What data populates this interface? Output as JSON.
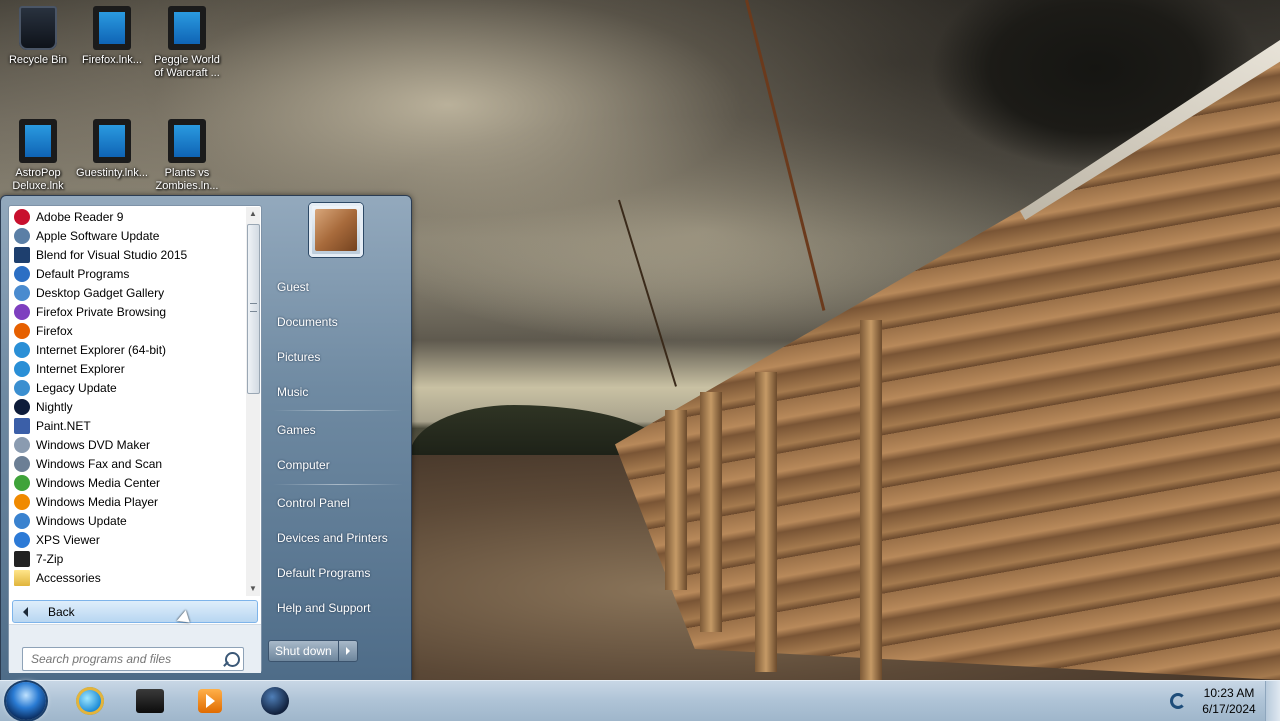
{
  "desktop": {
    "icons": [
      {
        "label": "Recycle Bin"
      },
      {
        "label": "Firefox.lnk..."
      },
      {
        "label": "Peggle World of Warcraft ..."
      },
      {
        "label": "AstroPop Deluxe.lnk"
      },
      {
        "label": "Guestinty.lnk..."
      },
      {
        "label": "Plants vs Zombies.ln..."
      }
    ]
  },
  "start_menu": {
    "programs": [
      {
        "label": "Adobe Reader 9",
        "icon": "adobe-reader-icon",
        "color": "#c8102e"
      },
      {
        "label": "Apple Software Update",
        "icon": "apple-update-icon",
        "color": "#5b7fa6"
      },
      {
        "label": "Blend for Visual Studio 2015",
        "icon": "blend-icon",
        "color": "#1e3f6e"
      },
      {
        "label": "Default Programs",
        "icon": "default-programs-icon",
        "color": "#2c6fc4"
      },
      {
        "label": "Desktop Gadget Gallery",
        "icon": "gadget-gallery-icon",
        "color": "#4a8bcf"
      },
      {
        "label": "Firefox Private Browsing",
        "icon": "firefox-private-icon",
        "color": "#7e3fbf"
      },
      {
        "label": "Firefox",
        "icon": "firefox-icon",
        "color": "#e66000"
      },
      {
        "label": "Internet Explorer (64-bit)",
        "icon": "internet-explorer-icon",
        "color": "#2a8fd6"
      },
      {
        "label": "Internet Explorer",
        "icon": "internet-explorer-icon",
        "color": "#2a8fd6"
      },
      {
        "label": "Legacy Update",
        "icon": "legacy-update-icon",
        "color": "#3b8fd0"
      },
      {
        "label": "Nightly",
        "icon": "nightly-icon",
        "color": "#0e1c3a"
      },
      {
        "label": "Paint.NET",
        "icon": "paint-net-icon",
        "color": "#3b5fa8"
      },
      {
        "label": "Windows DVD Maker",
        "icon": "dvd-maker-icon",
        "color": "#8a9bb0"
      },
      {
        "label": "Windows Fax and Scan",
        "icon": "fax-scan-icon",
        "color": "#6c7f95"
      },
      {
        "label": "Windows Media Center",
        "icon": "media-center-icon",
        "color": "#3fa33a"
      },
      {
        "label": "Windows Media Player",
        "icon": "media-player-icon",
        "color": "#f08a00"
      },
      {
        "label": "Windows Update",
        "icon": "windows-update-icon",
        "color": "#3a82cf"
      },
      {
        "label": "XPS Viewer",
        "icon": "xps-viewer-icon",
        "color": "#2d7ad6"
      },
      {
        "label": "7-Zip",
        "icon": "7zip-icon",
        "color": "#222222"
      },
      {
        "label": "Accessories",
        "icon": "folder-icon",
        "color": "#e8c25a"
      }
    ],
    "back_label": "Back",
    "search": {
      "placeholder": "Search programs and files"
    },
    "right_links": [
      {
        "label": "Guest"
      },
      {
        "label": "Documents"
      },
      {
        "label": "Pictures"
      },
      {
        "label": "Music"
      },
      {
        "label": "Games"
      },
      {
        "label": "Computer"
      },
      {
        "label": "Control Panel"
      },
      {
        "label": "Devices and Printers"
      },
      {
        "label": "Default Programs"
      },
      {
        "label": "Help and Support"
      }
    ],
    "shutdown_label": "Shut down"
  },
  "taskbar": {
    "apps": [
      {
        "icon": "internet-explorer-icon"
      },
      {
        "icon": "app-box-icon"
      },
      {
        "icon": "media-player-icon"
      },
      {
        "icon": "globe-icon"
      }
    ],
    "clock": {
      "time": "10:23 AM",
      "date": "6/17/2024"
    }
  },
  "colors": {
    "taskbar": "#aec3d6",
    "start_menu": "#6f8aa2",
    "accent": "#2a7bd3"
  }
}
